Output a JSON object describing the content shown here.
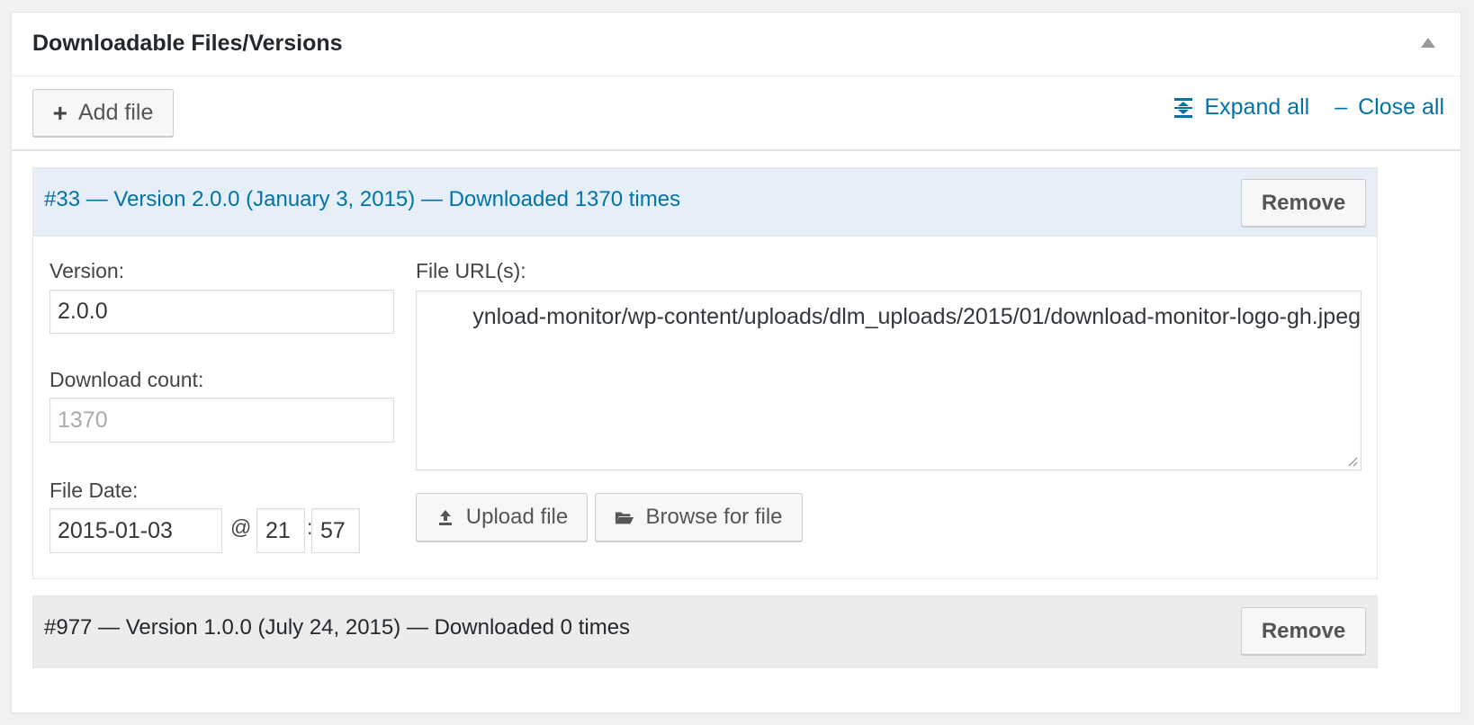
{
  "metabox": {
    "title": "Downloadable Files/Versions",
    "toggle_icon": "triangle-up-icon"
  },
  "toolbar": {
    "add_file_label": "Add file",
    "expand_all_label": "Expand all",
    "close_all_label": "Close all",
    "close_dash": "–"
  },
  "versions": [
    {
      "heading": "#33 — Version 2.0.0 (January 3, 2015) — Downloaded 1370 times",
      "remove_label": "Remove",
      "expanded": true,
      "version_label": "Version:",
      "version_value": "2.0.0",
      "download_count_label": "Download count:",
      "download_count_value": "1370",
      "file_date_label": "File Date:",
      "file_date_value": "2015-01-03",
      "at_sign": "@",
      "hour_value": "21",
      "time_sep": ":",
      "minute_value": "57",
      "file_urls_label": "File URL(s):",
      "file_url_value": "ynload-monitor/wp-content/uploads/dlm_uploads/2015/01/download-monitor-logo-gh.jpeg",
      "upload_label": "Upload file",
      "browse_label": "Browse for file"
    },
    {
      "heading": "#977 — Version 1.0.0 (July 24, 2015) — Downloaded 0 times",
      "remove_label": "Remove",
      "expanded": false
    }
  ],
  "colors": {
    "link": "#0073aa",
    "header_open_bg": "#e6eff8",
    "header_closed_bg": "#ececec"
  }
}
